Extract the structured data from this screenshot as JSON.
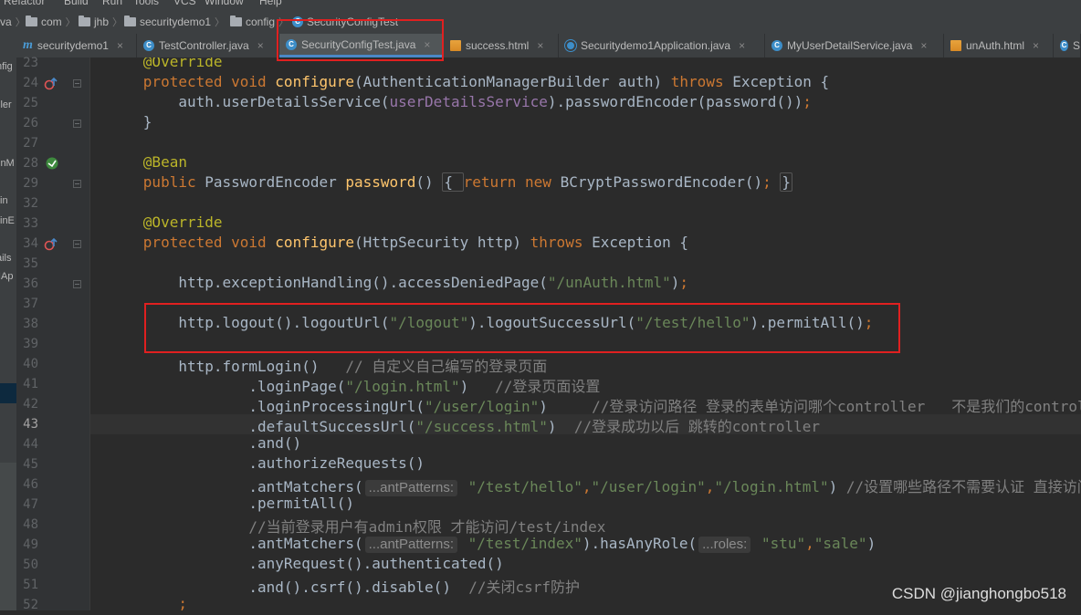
{
  "menubar": {
    "items": [
      "Refactor",
      "Build",
      "Run",
      "Tools",
      "VCS",
      "Window",
      "Help"
    ]
  },
  "breadcrumb": {
    "first": "va",
    "items": [
      "com",
      "jhb",
      "securitydemo1",
      "config",
      "SecurityConfigTest"
    ]
  },
  "tabs": [
    {
      "label": "securitydemo1",
      "icon": "m"
    },
    {
      "label": "TestController.java",
      "icon": "c"
    },
    {
      "label": "SecurityConfigTest.java",
      "icon": "c",
      "active": true
    },
    {
      "label": "success.html",
      "icon": "html"
    },
    {
      "label": "Securitydemo1Application.java",
      "icon": "app"
    },
    {
      "label": "MyUserDetailService.java",
      "icon": "c"
    },
    {
      "label": "unAuth.html",
      "icon": "html"
    },
    {
      "label": "S",
      "icon": "c"
    }
  ],
  "left_stubs": [
    "nfig",
    "ller",
    "inM",
    "in",
    "inE",
    "ails",
    "IAp"
  ],
  "code": {
    "current_line": "43",
    "lines": [
      {
        "n": "23",
        "toks": [
          [
            "      ",
            "pl"
          ],
          [
            "@Override",
            "an"
          ]
        ]
      },
      {
        "n": "24",
        "toks": [
          [
            "      ",
            "pl"
          ],
          [
            "protected ",
            "kw"
          ],
          [
            "void ",
            "kw"
          ],
          [
            "configure",
            "fn"
          ],
          [
            "(AuthenticationManagerBuilder auth) ",
            "pl"
          ],
          [
            "throws ",
            "kw"
          ],
          [
            "Exception {",
            "pl"
          ]
        ]
      },
      {
        "n": "25",
        "toks": [
          [
            "          auth.userDetailsService(",
            "pl"
          ],
          [
            "userDetailsService",
            "fld"
          ],
          [
            ").passwordEncoder(password())",
            "pl"
          ],
          [
            ";",
            "kw"
          ]
        ]
      },
      {
        "n": "26",
        "toks": [
          [
            "      }",
            "pl"
          ]
        ]
      },
      {
        "n": "27",
        "toks": []
      },
      {
        "n": "28",
        "toks": [
          [
            "      ",
            "pl"
          ],
          [
            "@Bean",
            "an"
          ]
        ]
      },
      {
        "n": "29",
        "toks": [
          [
            "      ",
            "pl"
          ],
          [
            "public ",
            "kw"
          ],
          [
            "PasswordEncoder ",
            "pl"
          ],
          [
            "password",
            "fn"
          ],
          [
            "() ",
            "pl"
          ],
          [
            "{ ",
            "box"
          ],
          [
            "return ",
            "kw"
          ],
          [
            "new ",
            "kw"
          ],
          [
            "BCryptPasswordEncoder()",
            "pl"
          ],
          [
            "; ",
            "kw"
          ],
          [
            "}",
            "box"
          ]
        ]
      },
      {
        "n": "32",
        "toks": []
      },
      {
        "n": "33",
        "toks": [
          [
            "      ",
            "pl"
          ],
          [
            "@Override",
            "an"
          ]
        ]
      },
      {
        "n": "34",
        "toks": [
          [
            "      ",
            "pl"
          ],
          [
            "protected ",
            "kw"
          ],
          [
            "void ",
            "kw"
          ],
          [
            "configure",
            "fn"
          ],
          [
            "(HttpSecurity http) ",
            "pl"
          ],
          [
            "throws ",
            "kw"
          ],
          [
            "Exception {",
            "pl"
          ]
        ]
      },
      {
        "n": "35",
        "toks": []
      },
      {
        "n": "36",
        "toks": [
          [
            "          http.exceptionHandling().accessDeniedPage(",
            "pl"
          ],
          [
            "\"/unAuth.html\"",
            "st"
          ],
          [
            ")",
            "pl"
          ],
          [
            ";",
            "kw"
          ]
        ]
      },
      {
        "n": "37",
        "toks": []
      },
      {
        "n": "38",
        "toks": [
          [
            "          http.logout().logoutUrl(",
            "pl"
          ],
          [
            "\"/logout\"",
            "st"
          ],
          [
            ").logoutSuccessUrl(",
            "pl"
          ],
          [
            "\"/test/hello\"",
            "st"
          ],
          [
            ").permitAll()",
            "pl"
          ],
          [
            ";",
            "kw"
          ]
        ]
      },
      {
        "n": "39",
        "toks": []
      },
      {
        "n": "40",
        "toks": [
          [
            "          http.formLogin()   ",
            "pl"
          ],
          [
            "// 自定义自己编写的登录页面",
            "cm"
          ]
        ]
      },
      {
        "n": "41",
        "toks": [
          [
            "                  .loginPage(",
            "pl"
          ],
          [
            "\"/login.html\"",
            "st"
          ],
          [
            ")   ",
            "pl"
          ],
          [
            "//登录页面设置",
            "cm"
          ]
        ]
      },
      {
        "n": "42",
        "toks": [
          [
            "                  .loginProcessingUrl(",
            "pl"
          ],
          [
            "\"/user/login\"",
            "st"
          ],
          [
            ")     ",
            "pl"
          ],
          [
            "//登录访问路径 登录的表单访问哪个controller   不是我们的controller",
            "cm"
          ]
        ]
      },
      {
        "n": "43",
        "toks": [
          [
            "                  .defaultSuccessUrl(",
            "pl"
          ],
          [
            "\"/success.html\"",
            "st"
          ],
          [
            ")  ",
            "pl"
          ],
          [
            "//登录成功以后 跳转的controller",
            "cm"
          ]
        ]
      },
      {
        "n": "44",
        "toks": [
          [
            "                  .and()",
            "pl"
          ]
        ]
      },
      {
        "n": "45",
        "toks": [
          [
            "                  .authorizeRequests()",
            "pl"
          ]
        ]
      },
      {
        "n": "46",
        "toks": [
          [
            "                  .antMatchers(",
            "pl"
          ],
          [
            "...antPatterns:",
            "hint"
          ],
          [
            " ",
            "pl"
          ],
          [
            "\"/test/hello\"",
            "st"
          ],
          [
            ",",
            "kw"
          ],
          [
            "\"/user/login\"",
            "st"
          ],
          [
            ",",
            "kw"
          ],
          [
            "\"/login.html\"",
            "st"
          ],
          [
            ") ",
            "pl"
          ],
          [
            "//设置哪些路径不需要认证 直接访问",
            "cm"
          ]
        ]
      },
      {
        "n": "47",
        "toks": [
          [
            "                  .permitAll()",
            "pl"
          ]
        ]
      },
      {
        "n": "48",
        "toks": [
          [
            "                  ",
            "pl"
          ],
          [
            "//当前登录用户有admin权限 才能访问/test/index",
            "cm"
          ]
        ]
      },
      {
        "n": "49",
        "toks": [
          [
            "                  .antMatchers(",
            "pl"
          ],
          [
            "...antPatterns:",
            "hint"
          ],
          [
            " ",
            "pl"
          ],
          [
            "\"/test/index\"",
            "st"
          ],
          [
            ").hasAnyRole(",
            "pl"
          ],
          [
            "...roles:",
            "hint"
          ],
          [
            " ",
            "pl"
          ],
          [
            "\"stu\"",
            "st"
          ],
          [
            ",",
            "kw"
          ],
          [
            "\"sale\"",
            "st"
          ],
          [
            ")",
            "pl"
          ]
        ]
      },
      {
        "n": "50",
        "toks": [
          [
            "                  .anyRequest().authenticated()",
            "pl"
          ]
        ]
      },
      {
        "n": "51",
        "toks": [
          [
            "                  .and().csrf().disable()  ",
            "pl"
          ],
          [
            "//关闭csrf防护",
            "cm"
          ]
        ]
      },
      {
        "n": "52",
        "toks": [
          [
            "          ",
            "pl"
          ],
          [
            ";",
            "kw"
          ]
        ]
      }
    ]
  },
  "watermark": "CSDN @jianghongbo518",
  "colors": {
    "annotation": "#bbb529",
    "keyword": "#cc7832",
    "string": "#6a8759",
    "comment": "#808080",
    "function": "#ffc66d",
    "highlight_box": "#e02020"
  }
}
